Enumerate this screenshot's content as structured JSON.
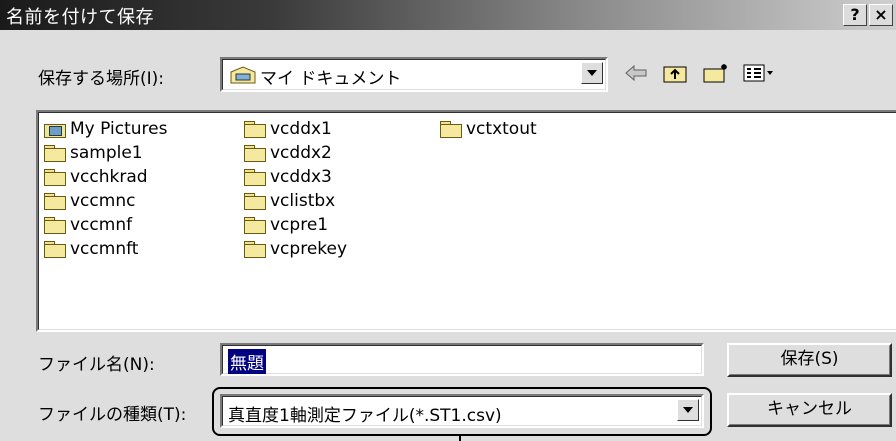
{
  "window": {
    "title": "名前を付けて保存",
    "help_label": "?",
    "close_label": "×"
  },
  "location": {
    "label": "保存する場所(I):",
    "value": "マイ ドキュメント"
  },
  "toolbar": {
    "back_icon": "arrow-left-icon",
    "up_icon": "folder-up-icon",
    "new_folder_icon": "new-folder-icon",
    "view_icon": "view-menu-icon"
  },
  "files": [
    {
      "name": "My Pictures",
      "icon": "pictures-folder-icon"
    },
    {
      "name": "sample1",
      "icon": "folder-icon"
    },
    {
      "name": "vcchkrad",
      "icon": "folder-icon"
    },
    {
      "name": "vccmnc",
      "icon": "folder-icon"
    },
    {
      "name": "vccmnf",
      "icon": "folder-icon"
    },
    {
      "name": "vccmnft",
      "icon": "folder-icon"
    },
    {
      "name": "vcddx1",
      "icon": "folder-icon"
    },
    {
      "name": "vcddx2",
      "icon": "folder-icon"
    },
    {
      "name": "vcddx3",
      "icon": "folder-icon"
    },
    {
      "name": "vclistbx",
      "icon": "folder-icon"
    },
    {
      "name": "vcpre1",
      "icon": "folder-icon"
    },
    {
      "name": "vcprekey",
      "icon": "folder-icon"
    },
    {
      "name": "vctxtout",
      "icon": "folder-icon"
    }
  ],
  "filename": {
    "label": "ファイル名(N):",
    "value": "無題"
  },
  "filetype": {
    "label": "ファイルの種類(T):",
    "value": "真直度1軸測定ファイル(*.ST1.csv)"
  },
  "buttons": {
    "save": "保存(S)",
    "cancel": "キャンセル"
  },
  "colors": {
    "face": "#dedede",
    "selection": "#000080"
  }
}
